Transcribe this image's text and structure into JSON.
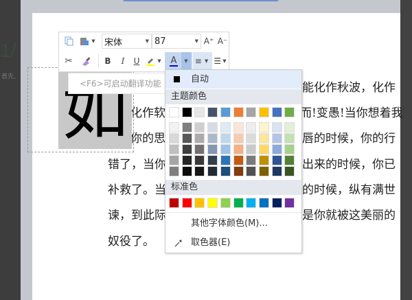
{
  "sidebar": {
    "page_number": "1/",
    "note": "首先,"
  },
  "document": {
    "drop_cap": "如",
    "lines": [
      "能化作秋波，化作",
      "化作软",
      "而!变愚!当你想着我",
      "你的思",
      "唇的时候，你的行",
      "错了，当你",
      "出来的时候，你已",
      "补救了。当",
      "的时候，纵有满世",
      "谏，到此际",
      "是你就被这美丽的",
      "奴役了。"
    ]
  },
  "tooltip": {
    "text": "<F6>可启动翻译功能"
  },
  "toolbar": {
    "font_name": "宋体",
    "font_size": "87",
    "grow_font": "A⁺",
    "shrink_font": "A⁻",
    "bold": "B",
    "italic": "I",
    "underline": "U",
    "font_color": "A",
    "font_color_value": "#0000ff",
    "highlight_color": "#ffff00"
  },
  "color_menu": {
    "auto_label": "自动",
    "theme_title": "主题颜色",
    "theme_top": [
      "#ffffff",
      "#000000",
      "#e7e6e6",
      "#44546a",
      "#5b9bd5",
      "#ed7d31",
      "#a5a5a5",
      "#ffc000",
      "#4472c4",
      "#70ad47"
    ],
    "theme_shades": [
      [
        "#f2f2f2",
        "#7f7f7f",
        "#d0cece",
        "#d6dce4",
        "#deebf6",
        "#fbe5d5",
        "#ededed",
        "#fff2cc",
        "#dae3f3",
        "#e2efd9"
      ],
      [
        "#d8d8d8",
        "#595959",
        "#aeabab",
        "#adb9ca",
        "#bdd7ee",
        "#f7cbac",
        "#dbdbdb",
        "#fee599",
        "#b4c6e7",
        "#c5e0b3"
      ],
      [
        "#bfbfbf",
        "#3f3f3f",
        "#757070",
        "#8496b0",
        "#9cc3e5",
        "#f4b183",
        "#c9c9c9",
        "#ffd965",
        "#8eaadb",
        "#a8d08d"
      ],
      [
        "#a5a5a5",
        "#262626",
        "#3a3838",
        "#323f4f",
        "#2e75b5",
        "#c55a11",
        "#7b7b7b",
        "#bf9000",
        "#2f5496",
        "#538135"
      ],
      [
        "#7f7f7f",
        "#0c0c0c",
        "#171616",
        "#222a35",
        "#1e4e79",
        "#833c0b",
        "#525252",
        "#7f6000",
        "#1f3864",
        "#375623"
      ]
    ],
    "standard_title": "标准色",
    "standard": [
      "#c00000",
      "#ff0000",
      "#ffc000",
      "#ffff00",
      "#92d050",
      "#00b050",
      "#00b0f0",
      "#0070c0",
      "#002060",
      "#7030a0"
    ],
    "more_colors": "其他字体颜色(M)...",
    "eyedropper": "取色器(E)"
  }
}
